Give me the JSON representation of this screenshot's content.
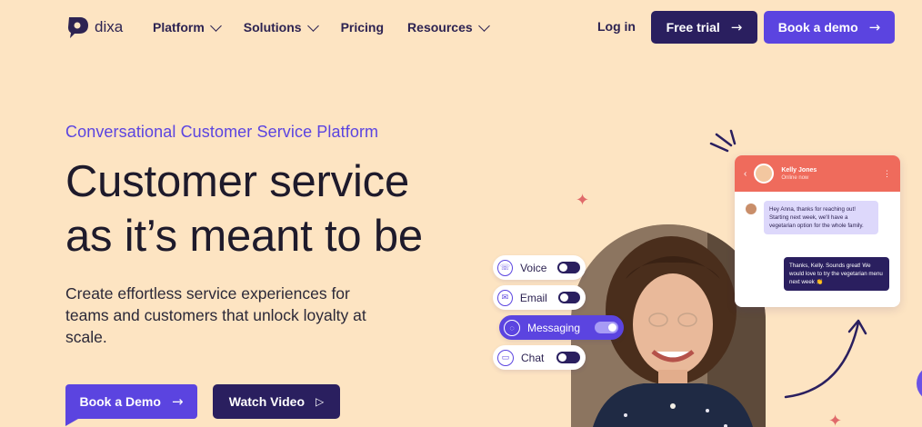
{
  "header": {
    "logo_text": "dixa",
    "nav": [
      {
        "label": "Platform",
        "has_dropdown": true
      },
      {
        "label": "Solutions",
        "has_dropdown": true
      },
      {
        "label": "Pricing",
        "has_dropdown": false
      },
      {
        "label": "Resources",
        "has_dropdown": true
      }
    ],
    "login_label": "Log in",
    "free_trial_label": "Free trial",
    "book_demo_label": "Book a demo"
  },
  "hero": {
    "eyebrow": "Conversational Customer Service Platform",
    "headline_line1": "Customer service",
    "headline_line2": "as it’s meant to be",
    "subtext": "Create effortless service experiences for teams and customers that unlock loyalty at scale.",
    "cta_primary": "Book a Demo",
    "cta_secondary": "Watch Video"
  },
  "channels": [
    {
      "label": "Voice",
      "enabled": false
    },
    {
      "label": "Email",
      "enabled": false
    },
    {
      "label": "Messaging",
      "enabled": true
    },
    {
      "label": "Chat",
      "enabled": false
    }
  ],
  "chat_widget": {
    "agent_name": "Kelly Jones",
    "agent_status": "Online now",
    "incoming_message": "Hey Anna, thanks for reaching out! Starting next week, we'll have a vegetarian option for the whole family.",
    "outgoing_message": "Thanks, Kelly. Sounds great! We would love to try the vegetarian menu next week 👏"
  },
  "colors": {
    "background": "#fde4c2",
    "brand_purple": "#5b44e0",
    "brand_dark": "#2a1f5f",
    "coral": "#ef6b5c"
  },
  "icons": [
    "dixa-logo-icon",
    "chevron-down-icon",
    "arrow-right-icon",
    "play-icon",
    "phone-icon",
    "mail-icon",
    "message-icon",
    "chat-icon",
    "sparkle-icon"
  ]
}
